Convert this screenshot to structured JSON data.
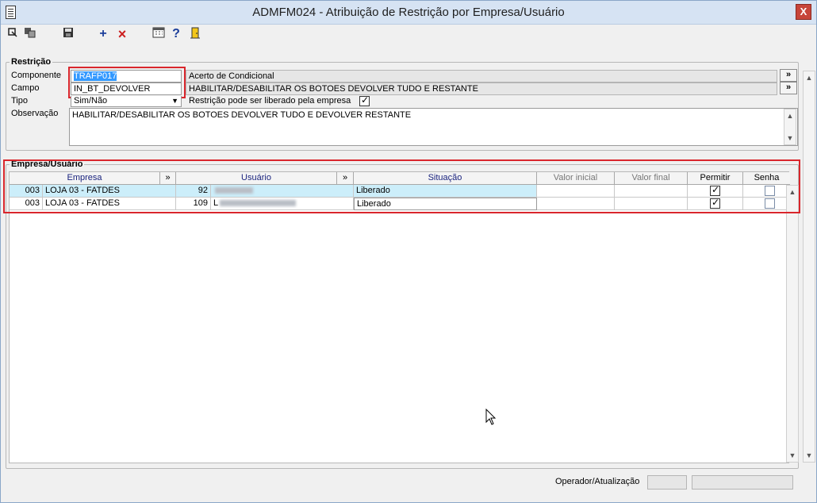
{
  "window": {
    "title": "ADMFM024 - Atribuição de Restrição por Empresa/Usuário",
    "close_label": "X"
  },
  "toolbar": {
    "icons": [
      "enter-icon",
      "copy-icon",
      "save-icon",
      "add-icon",
      "delete-icon",
      "calculator-icon",
      "help-icon",
      "exit-icon"
    ],
    "add_glyph": "+",
    "delete_glyph": "×",
    "help_glyph": "?"
  },
  "restricao": {
    "group_label": "Restrição",
    "componente_label": "Componente",
    "componente_value": "TRAFP017",
    "componente_desc": "Acerto de Condicional",
    "campo_label": "Campo",
    "campo_value": "IN_BT_DEVOLVER",
    "campo_desc": "HABILITAR/DESABILITAR OS BOTOES DEVOLVER TUDO E RESTANTE",
    "tipo_label": "Tipo",
    "tipo_value": "Sim/Não",
    "liberado_label": "Restrição pode ser liberado pela empresa",
    "liberado_checked": true,
    "observacao_label": "Observação",
    "observacao_value": "HABILITAR/DESABILITAR OS BOTOES DEVOLVER TUDO E DEVOLVER RESTANTE",
    "more_label": "»"
  },
  "grid": {
    "group_label": "Empresa/Usuário",
    "columns": {
      "empresa": "Empresa",
      "usuario": "Usuário",
      "situacao": "Situação",
      "valor_inicial": "Valor inicial",
      "valor_final": "Valor final",
      "permitir": "Permitir",
      "senha": "Senha",
      "more": "»"
    },
    "rows": [
      {
        "empresa_cod": "003",
        "empresa_nome": "LOJA 03 - FATDES",
        "usuario_cod": "92",
        "situacao": "Liberado",
        "valor_inicial": "",
        "valor_final": "",
        "permitir": true,
        "senha": false
      },
      {
        "empresa_cod": "003",
        "empresa_nome": "LOJA 03 - FATDES",
        "usuario_cod": "109",
        "usuario_initial": "L",
        "situacao": "Liberado",
        "valor_inicial": "",
        "valor_final": "",
        "permitir": true,
        "senha": false
      }
    ]
  },
  "footer": {
    "operador_label": "Operador/Atualização"
  },
  "colors": {
    "highlight_red": "#d9262c",
    "selected_row": "#cceefa",
    "selection_blue": "#3399ff"
  }
}
